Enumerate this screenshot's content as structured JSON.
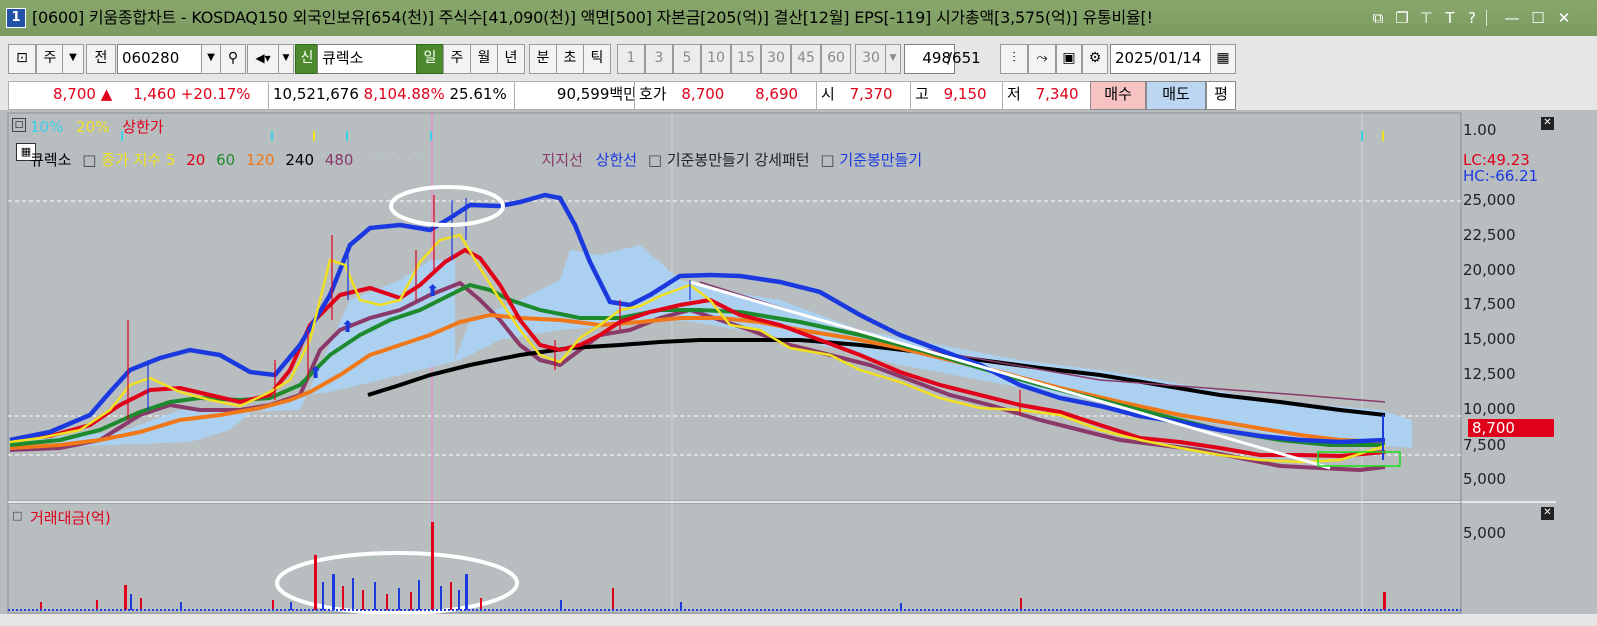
{
  "window": {
    "number": "1",
    "title": "[0600] 키움종합차트 - KOSDAQ150 외국인보유[654(천)] 주식수[41,090(천)] 액면[500] 자본금[205(억)] 결산[12월] EPS[-119] 시가총액[3,575(억)] 유통비율[!"
  },
  "toolbar": {
    "mode_label": "주",
    "jeon_label": "전",
    "code_value": "060280",
    "sin_label": "신",
    "stock_name": "큐렉소",
    "periods": [
      "일",
      "주",
      "월",
      "년",
      "분",
      "초",
      "틱"
    ],
    "intervals": [
      "1",
      "3",
      "5",
      "10",
      "15",
      "30",
      "45",
      "60"
    ],
    "interval_select": "30",
    "count_value": "498",
    "count_total": "/651",
    "date_value": "2025/01/14"
  },
  "quote": {
    "price": "8,700",
    "change_arrow": "▲",
    "change": "1,460",
    "change_pct": "+20.17%",
    "volume": "10,521,676",
    "volume_ratio": "8,104.88%",
    "turnover": "25.61%",
    "amount": "90,599백만",
    "hoga_label": "호가",
    "ask": "8,700",
    "bid": "8,690",
    "open_label": "시",
    "open": "7,370",
    "high_label": "고",
    "high": "9,150",
    "low_label": "저",
    "low": "7,340",
    "buy_label": "매수",
    "sell_label": "매도",
    "pyeong_label": "평"
  },
  "price_panel": {
    "top_legend": [
      "10%",
      "20%",
      "상한가"
    ],
    "top_legend_colors": [
      "#3ad0e8",
      "#f0e020",
      "#e0001a"
    ],
    "legend_items": [
      {
        "text": "큐렉소",
        "color": "#000000"
      },
      {
        "text": "종가 지수 5",
        "color": "#f0e020"
      },
      {
        "text": "20",
        "color": "#e0001a"
      },
      {
        "text": "60",
        "color": "#1e8a2e"
      },
      {
        "text": "120",
        "color": "#f07818"
      },
      {
        "text": "240",
        "color": "#000000"
      },
      {
        "text": "480",
        "color": "#8a3a6a"
      },
      {
        "text": "지지선",
        "color": "#8a3a6a"
      },
      {
        "text": "상한선",
        "color": "#1a3ae0"
      },
      {
        "text": "기준봉만들기 강세패턴",
        "color": "#222222"
      },
      {
        "text": "기준봉만들기",
        "color": "#1a3ae0"
      }
    ],
    "lc_label": "LC:49.23",
    "hc_label": "HC:-66.21",
    "price_tag": "8,700",
    "y_ticks": [
      "1.00",
      "25,000",
      "22,500",
      "20,000",
      "17,500",
      "15,000",
      "12,500",
      "10,000",
      "7,500",
      "5,000"
    ]
  },
  "volume_panel": {
    "title": "거래대금(억)",
    "y_ticks": [
      "5,000"
    ]
  },
  "colors": {
    "chart_bg": "#b8bdc0",
    "ma5": "#f0e020",
    "ma20": "#e0001a",
    "ma60": "#1e8a2e",
    "ma120": "#f07818",
    "ma240": "#000000",
    "ma480": "#8a3a6a",
    "upper_band": "#1a3ae0",
    "cloud": "#a8d4f8",
    "volume_up": "#e0001a",
    "volume_down": "#1a3ae0"
  }
}
